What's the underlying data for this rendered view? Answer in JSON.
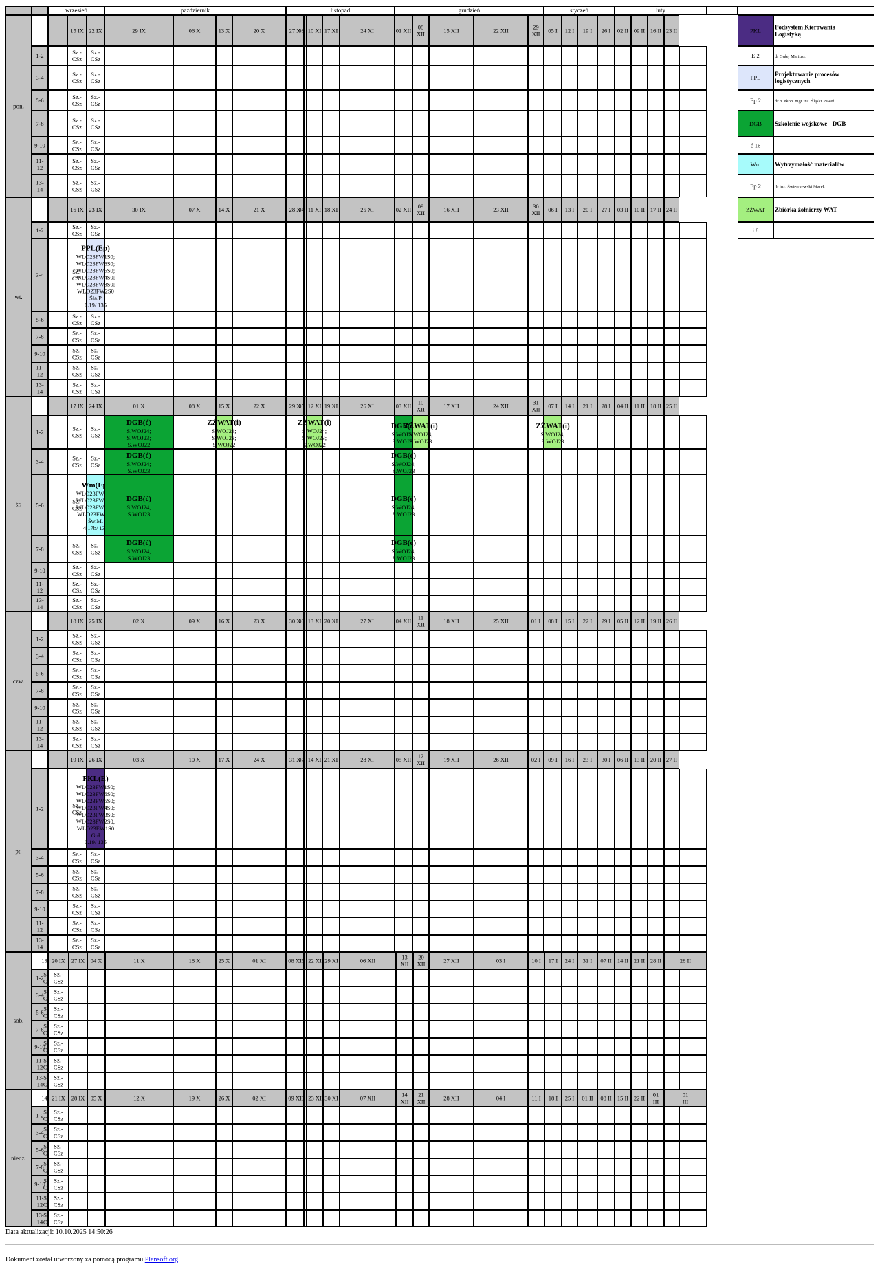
{
  "months": [
    {
      "label": "wrzesień",
      "from": 2,
      "to": 4
    },
    {
      "label": "październik",
      "from": 5,
      "to": 8
    },
    {
      "label": "listopad",
      "from": 9,
      "to": 13
    },
    {
      "label": "grudzień",
      "from": 14,
      "to": 18
    },
    {
      "label": "styczeń",
      "from": 19,
      "to": 22
    },
    {
      "label": "luty",
      "from": 23,
      "to": 27
    }
  ],
  "slot_labels": [
    "1-2",
    "3-4",
    "5-6",
    "7-8",
    "9-10",
    "11-12",
    "13-14"
  ],
  "slot_filler": "Sz.-CSz",
  "days": [
    {
      "name": "pon.",
      "dates": [
        "",
        "15 IX",
        "22 IX",
        "29 IX",
        "06 X",
        "13 X",
        "20 X",
        "27 X",
        "03 XI",
        "10 XI",
        "17 XI",
        "24 XI",
        "01 XII",
        "08 XII",
        "15 XII",
        "22 XII",
        "29 XII",
        "05 I",
        "12 I",
        "19 I",
        "26 I",
        "02 II",
        "09 II",
        "16 II",
        "23 II"
      ],
      "filler_cols": [
        1,
        2
      ]
    },
    {
      "name": "wt.",
      "dates": [
        "",
        "16 IX",
        "23 IX",
        "30 IX",
        "07 X",
        "14 X",
        "21 X",
        "28 X",
        "04 XI",
        "11 XI",
        "18 XI",
        "25 XI",
        "02 XII",
        "09 XII",
        "16 XII",
        "23 XII",
        "30 XII",
        "06 I",
        "13 I",
        "20 I",
        "27 I",
        "03 II",
        "10 II",
        "17 II",
        "24 II"
      ],
      "filler_cols": [
        1,
        2
      ]
    },
    {
      "name": "śr.",
      "dates": [
        "",
        "17 IX",
        "24 IX",
        "01 X",
        "08 X",
        "15 X",
        "22 X",
        "29 X",
        "05 XI",
        "12 XI",
        "19 XI",
        "26 XI",
        "03 XII",
        "10 XII",
        "17 XII",
        "24 XII",
        "31 XII",
        "07 I",
        "14 I",
        "21 I",
        "28 I",
        "04 II",
        "11 II",
        "18 II",
        "25 II"
      ],
      "filler_cols": [
        1,
        2
      ]
    },
    {
      "name": "czw.",
      "dates": [
        "",
        "18 IX",
        "25 IX",
        "02 X",
        "09 X",
        "16 X",
        "23 X",
        "30 X",
        "06 XI",
        "13 XI",
        "20 XI",
        "27 XI",
        "04 XII",
        "11 XII",
        "18 XII",
        "25 XII",
        "01 I",
        "08 I",
        "15 I",
        "22 I",
        "29 I",
        "05 II",
        "12 II",
        "19 II",
        "26 II"
      ],
      "filler_cols": [
        1,
        2
      ]
    },
    {
      "name": "pt.",
      "dates": [
        "",
        "19 IX",
        "26 IX",
        "03 X",
        "10 X",
        "17 X",
        "24 X",
        "31 X",
        "07 XI",
        "14 XI",
        "21 XI",
        "28 XI",
        "05 XII",
        "12 XII",
        "19 XII",
        "26 XII",
        "02 I",
        "09 I",
        "16 I",
        "23 I",
        "30 I",
        "06 II",
        "13 II",
        "20 II",
        "27 II"
      ],
      "filler_cols": [
        1,
        2
      ]
    },
    {
      "name": "sob.",
      "dates": [
        "13 IX",
        "20 IX",
        "27 IX",
        "04 X",
        "11 X",
        "18 X",
        "25 X",
        "01 XI",
        "08 XI",
        "15 XI",
        "22 XI",
        "29 XI",
        "06 XII",
        "13 XII",
        "20 XII",
        "27 XII",
        "03 I",
        "10 I",
        "17 I",
        "24 I",
        "31 I",
        "07 II",
        "14 II",
        "21 II",
        "28 II"
      ],
      "filler_cols": [
        0,
        1
      ]
    },
    {
      "name": "niedz.",
      "dates": [
        "14 IX",
        "21 IX",
        "28 IX",
        "05 X",
        "12 X",
        "19 X",
        "26 X",
        "02 XI",
        "09 XI",
        "16 XI",
        "23 XI",
        "30 XI",
        "07 XII",
        "14 XII",
        "21 XII",
        "28 XII",
        "04 I",
        "11 I",
        "18 I",
        "25 I",
        "01 II",
        "08 II",
        "15 II",
        "22 II",
        "01 III"
      ],
      "filler_cols": [
        0,
        1
      ]
    }
  ],
  "events": [
    {
      "day": 1,
      "slot": 1,
      "col": 3,
      "code": "PPL",
      "title": "PPL(Ep)",
      "lines": [
        "WLO23FW1S0;",
        "WLO23FW6S0;",
        "WLO23FW5S0;",
        "WLO23FW4S0;",
        "WLO23FW3S0;",
        "WLO23FW2S0",
        "Śla.P",
        "0.19/ 135"
      ]
    },
    {
      "day": 2,
      "slot": 0,
      "col": 4,
      "code": "DGB",
      "title": "DGB(ć)",
      "lines": [
        "S.WOJ24;",
        "S.WOJ23;",
        "S.WOJ22"
      ]
    },
    {
      "day": 2,
      "slot": 0,
      "col": 6,
      "code": "ZŻWAT",
      "title": "ZŻWAT(i)",
      "lines": [
        "S.WOJ24;",
        "S.WOJ23;",
        "S.WOJ22"
      ]
    },
    {
      "day": 2,
      "slot": 0,
      "col": 10,
      "code": "ZŻWAT",
      "title": "ZŻWAT(i)",
      "lines": [
        "S.WOJ24;",
        "S.WOJ23;",
        "S.WOJ22"
      ]
    },
    {
      "day": 2,
      "slot": 0,
      "col": 13,
      "code": "DGB",
      "title": "DGB(ć)",
      "lines": [
        "S.WOJ24;",
        "S.WOJ23"
      ]
    },
    {
      "day": 2,
      "slot": 0,
      "col": 14,
      "code": "ZŻWAT",
      "title": "ZŻWAT(i)",
      "lines": [
        "S.WOJ24;",
        "S.WOJ23"
      ]
    },
    {
      "day": 2,
      "slot": 0,
      "col": 18,
      "code": "ZŻWAT",
      "title": "ZŻWAT(i)",
      "lines": [
        "S.WOJ24;",
        "S.WOJ23"
      ]
    },
    {
      "day": 2,
      "slot": 1,
      "col": 4,
      "code": "DGB",
      "title": "DGB(ć)",
      "lines": [
        "S.WOJ24;",
        "S.WOJ23"
      ]
    },
    {
      "day": 2,
      "slot": 1,
      "col": 13,
      "code": "DGB",
      "title": "DGB(ć)",
      "lines": [
        "S.WOJ24;",
        "S.WOJ23"
      ]
    },
    {
      "day": 2,
      "slot": 2,
      "col": 3,
      "code": "Wm",
      "title": "Wm(Ep)",
      "lines": [
        "WLO23FW4S0;",
        "WLO23FW3S0;",
        "WLO23FW2S0;",
        "WLO23FW1S0",
        "Św.M.",
        "4.17b/ 135"
      ]
    },
    {
      "day": 2,
      "slot": 2,
      "col": 4,
      "code": "DGB",
      "title": "DGB(ć)",
      "lines": [
        "S.WOJ24;",
        "S.WOJ23"
      ]
    },
    {
      "day": 2,
      "slot": 2,
      "col": 13,
      "code": "DGB",
      "title": "DGB(ć)",
      "lines": [
        "S.WOJ24;",
        "S.WOJ23"
      ]
    },
    {
      "day": 2,
      "slot": 3,
      "col": 4,
      "code": "DGB",
      "title": "DGB(ć)",
      "lines": [
        "S.WOJ24;",
        "S.WOJ23"
      ]
    },
    {
      "day": 2,
      "slot": 3,
      "col": 13,
      "code": "DGB",
      "title": "DGB(ć)",
      "lines": [
        "S.WOJ24;",
        "S.WOJ23"
      ]
    },
    {
      "day": 4,
      "slot": 0,
      "col": 3,
      "code": "PKL",
      "title": "PKL(E)",
      "lines": [
        "WLO23FW1S0;",
        "WLO23FW6S0;",
        "WLO23FW5S0;",
        "WLO23FW4S0;",
        "WLO23FW3S0;",
        "WLO23FW2S0;",
        "WLO23EW1S0",
        "Guł",
        "0.19/ 135"
      ]
    }
  ],
  "colors": {
    "PKL": {
      "bg": "#4b2c83",
      "fg": "#000000"
    },
    "PPL": {
      "bg": "#dde6fb",
      "fg": "#000000"
    },
    "DGB": {
      "bg": "#0ba434",
      "fg": "#000000"
    },
    "Wm": {
      "bg": "#a7fbfb",
      "fg": "#000000"
    },
    "ZŻWAT": {
      "bg": "#a4ef80",
      "fg": "#000000"
    },
    "gray": "#c3c3c3",
    "border": "#000000"
  },
  "legend": [
    {
      "code": "PKL",
      "name": "Podsystem Kierowania Logistyką",
      "row": 0,
      "kind": "subject"
    },
    {
      "code": "E 2",
      "name": "dr Gułej Mariusz",
      "row": 1,
      "kind": "person"
    },
    {
      "code": "PPL",
      "name": "Projektowanie procesów logistycznych",
      "row": 2,
      "kind": "subject"
    },
    {
      "code": "Ep 2",
      "name": "dr n. ekon. mgr inż. Śląski Paweł",
      "row": 3,
      "kind": "person"
    },
    {
      "code": "DGB",
      "name": "Szkolenie wojskowe - DGB",
      "row": 4,
      "kind": "subject"
    },
    {
      "code": "ć 16",
      "name": "",
      "row": 5,
      "kind": "person"
    },
    {
      "code": "Wm",
      "name": "Wytrzymałość materiałów",
      "row": 6,
      "kind": "subject"
    },
    {
      "code": "Ep 2",
      "name": "dr inż. Świerczewski Marek",
      "row": 7,
      "kind": "person"
    },
    {
      "code": "ZŻWAT",
      "name": "Zbiórka żołnierzy WAT",
      "row": 8,
      "kind": "subject"
    },
    {
      "code": "i 8",
      "name": "",
      "row": 9,
      "kind": "person"
    }
  ],
  "footer": {
    "updated": "Data aktualizacji: 10.10.2025 14:50:26",
    "created_prefix": "Dokument został utworzony za pomocą programu ",
    "created_link": "Plansoft.org"
  }
}
